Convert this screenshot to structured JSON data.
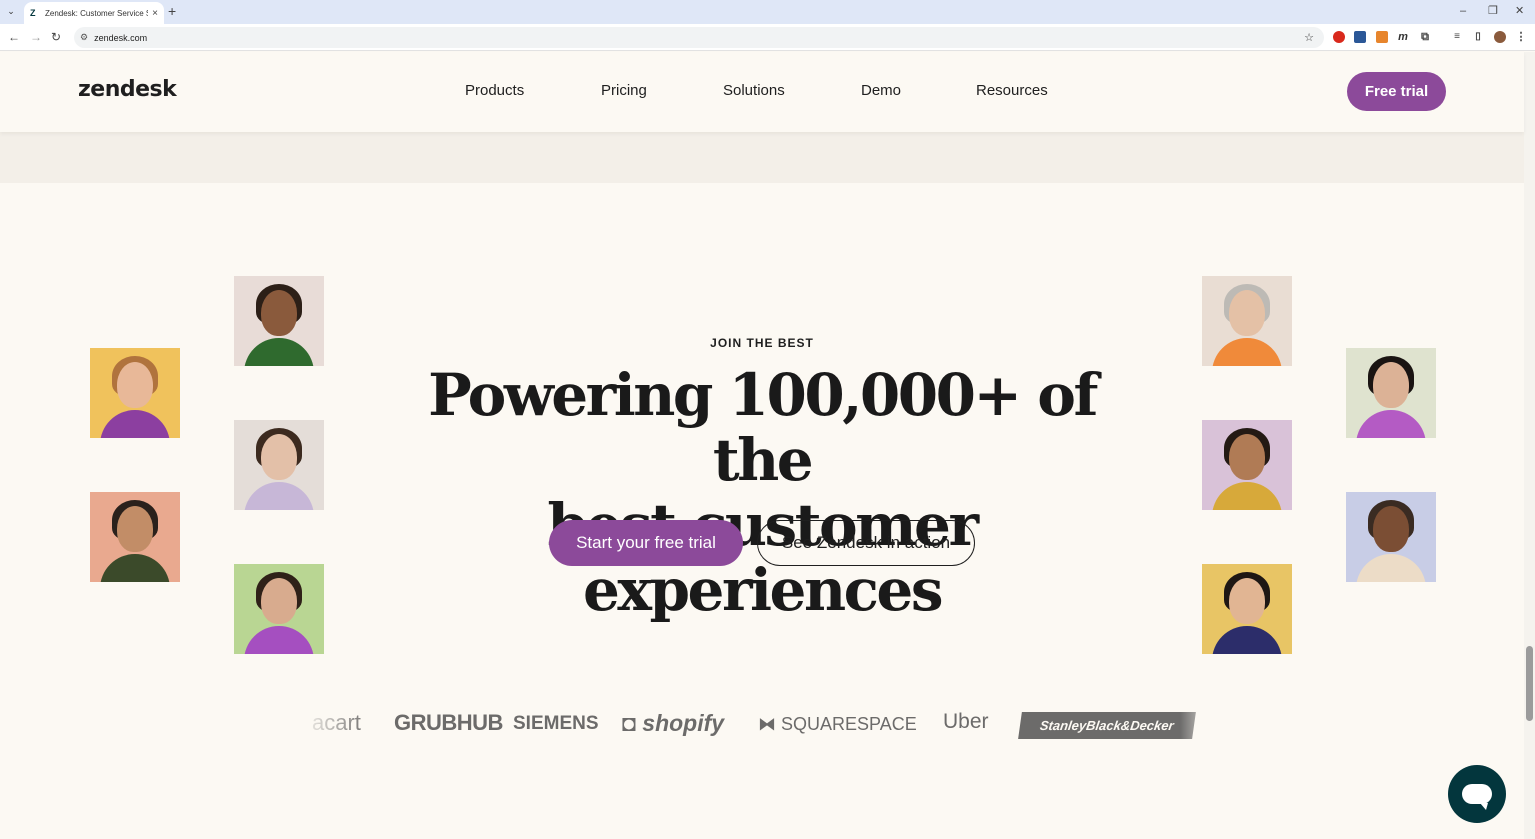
{
  "browser": {
    "tab_title": "Zendesk: Customer Service Soft",
    "url": "zendesk.com",
    "new_tab": "+",
    "minimize": "–",
    "restore": "❐",
    "close": "✕"
  },
  "header": {
    "logo": "zendesk",
    "nav": [
      "Products",
      "Pricing",
      "Solutions",
      "Demo",
      "Resources"
    ],
    "cta": "Free trial"
  },
  "hero": {
    "eyebrow": "JOIN THE BEST",
    "headline_line1": "Powering 100,000+ of the",
    "headline_line2": "best customer experiences",
    "primary_cta": "Start your free trial",
    "secondary_cta": "See Zendesk in action"
  },
  "logos": [
    "acart",
    "GRUBHUB",
    "SIEMENS",
    "shopify",
    "SQUARESPACE",
    "Uber",
    "StanleyBlack&Decker"
  ],
  "colors": {
    "brand_purple": "#8c4a9a",
    "page_bg": "#fcf9f3",
    "chat_bg": "#03363d"
  }
}
